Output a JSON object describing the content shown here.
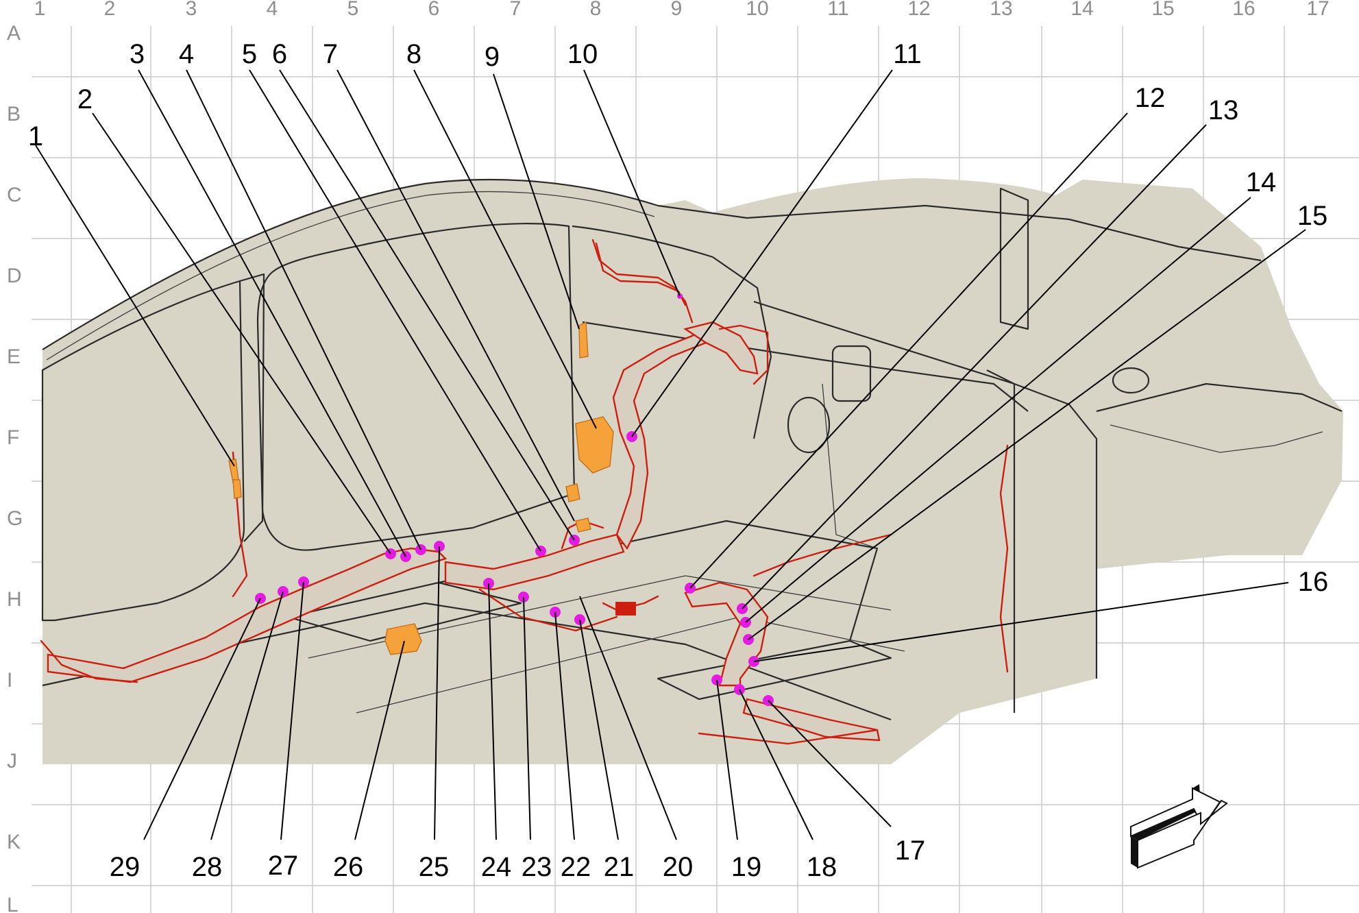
{
  "grid": {
    "columns": [
      "1",
      "2",
      "3",
      "4",
      "5",
      "6",
      "7",
      "8",
      "9",
      "10",
      "11",
      "12",
      "13",
      "14",
      "15",
      "16",
      "17"
    ],
    "rows": [
      "A",
      "B",
      "C",
      "D",
      "E",
      "F",
      "G",
      "H",
      "I",
      "J",
      "K",
      "L"
    ]
  },
  "callouts": [
    {
      "id": "1",
      "label": "1"
    },
    {
      "id": "2",
      "label": "2"
    },
    {
      "id": "3",
      "label": "3"
    },
    {
      "id": "4",
      "label": "4"
    },
    {
      "id": "5",
      "label": "5"
    },
    {
      "id": "6",
      "label": "6"
    },
    {
      "id": "7",
      "label": "7"
    },
    {
      "id": "8",
      "label": "8"
    },
    {
      "id": "9",
      "label": "9"
    },
    {
      "id": "10",
      "label": "10"
    },
    {
      "id": "11",
      "label": "11"
    },
    {
      "id": "12",
      "label": "12"
    },
    {
      "id": "13",
      "label": "13"
    },
    {
      "id": "14",
      "label": "14"
    },
    {
      "id": "15",
      "label": "15"
    },
    {
      "id": "16",
      "label": "16"
    },
    {
      "id": "17",
      "label": "17"
    },
    {
      "id": "18",
      "label": "18"
    },
    {
      "id": "19",
      "label": "19"
    },
    {
      "id": "20",
      "label": "20"
    },
    {
      "id": "21",
      "label": "21"
    },
    {
      "id": "22",
      "label": "22"
    },
    {
      "id": "23",
      "label": "23"
    },
    {
      "id": "24",
      "label": "24"
    },
    {
      "id": "25",
      "label": "25"
    },
    {
      "id": "26",
      "label": "26"
    },
    {
      "id": "27",
      "label": "27"
    },
    {
      "id": "28",
      "label": "28"
    },
    {
      "id": "29",
      "label": "29"
    }
  ],
  "colors": {
    "body_panel": "#d9d5c6",
    "frame_lines": "#2a2a2a",
    "harness": "#cc1f0f",
    "connector": "#e31be3",
    "bracket": "#f5a23a",
    "grid": "#c8c8c8",
    "grid_label": "#8e8e8e"
  },
  "icons": {
    "direction_arrow": "front-direction-arrow-icon"
  }
}
